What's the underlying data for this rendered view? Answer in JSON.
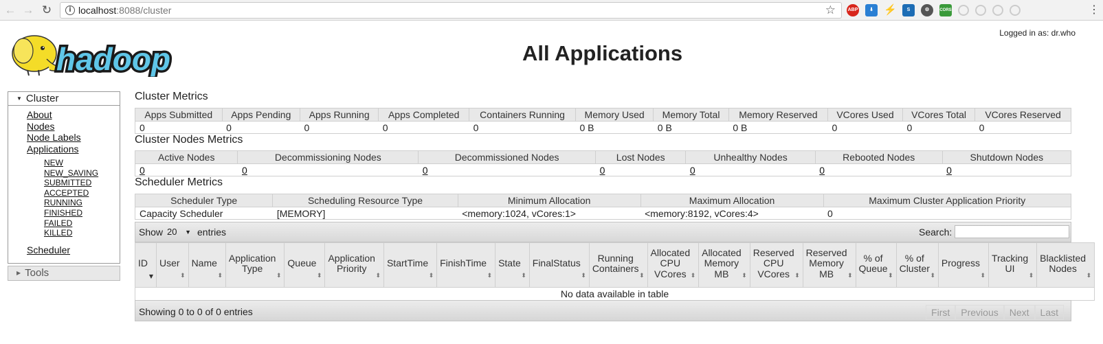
{
  "browser": {
    "url_host": "localhost",
    "url_path": ":8088/cluster"
  },
  "header": {
    "title": "All Applications",
    "logged_in": "Logged in as: dr.who",
    "logo_text": "hadoop"
  },
  "sidebar": {
    "cluster_label": "Cluster",
    "links": [
      "About",
      "Nodes",
      "Node Labels",
      "Applications"
    ],
    "states": [
      "NEW",
      "NEW_SAVING",
      "SUBMITTED",
      "ACCEPTED",
      "RUNNING",
      "FINISHED",
      "FAILED",
      "KILLED"
    ],
    "scheduler": "Scheduler",
    "tools_label": "Tools"
  },
  "cluster_metrics": {
    "title": "Cluster Metrics",
    "headers": [
      "Apps Submitted",
      "Apps Pending",
      "Apps Running",
      "Apps Completed",
      "Containers Running",
      "Memory Used",
      "Memory Total",
      "Memory Reserved",
      "VCores Used",
      "VCores Total",
      "VCores Reserved"
    ],
    "values": [
      "0",
      "0",
      "0",
      "0",
      "0",
      "0 B",
      "0 B",
      "0 B",
      "0",
      "0",
      "0"
    ]
  },
  "node_metrics": {
    "title": "Cluster Nodes Metrics",
    "headers": [
      "Active Nodes",
      "Decommissioning Nodes",
      "Decommissioned Nodes",
      "Lost Nodes",
      "Unhealthy Nodes",
      "Rebooted Nodes",
      "Shutdown Nodes"
    ],
    "values": [
      "0",
      "0",
      "0",
      "0",
      "0",
      "0",
      "0"
    ]
  },
  "scheduler_metrics": {
    "title": "Scheduler Metrics",
    "headers": [
      "Scheduler Type",
      "Scheduling Resource Type",
      "Minimum Allocation",
      "Maximum Allocation",
      "Maximum Cluster Application Priority"
    ],
    "values": [
      "Capacity Scheduler",
      "[MEMORY]",
      "<memory:1024, vCores:1>",
      "<memory:8192, vCores:4>",
      "0"
    ]
  },
  "apps_table": {
    "show_label": "Show",
    "entries_value": "20",
    "entries_label": "entries",
    "search_label": "Search:",
    "search_value": "",
    "columns": [
      "ID",
      "User",
      "Name",
      "Application Type",
      "Queue",
      "Application Priority",
      "StartTime",
      "FinishTime",
      "State",
      "FinalStatus",
      "Running Containers",
      "Allocated CPU VCores",
      "Allocated Memory MB",
      "Reserved CPU VCores",
      "Reserved Memory MB",
      "% of Queue",
      "% of Cluster",
      "Progress",
      "Tracking UI",
      "Blacklisted Nodes"
    ],
    "empty_message": "No data available in table",
    "info": "Showing 0 to 0 of 0 entries",
    "pager": [
      "First",
      "Previous",
      "Next",
      "Last"
    ]
  },
  "colors": {
    "logo_blue": "#5fc6e8",
    "logo_yellow": "#f4dc28",
    "header_gray": "#e8e8e8"
  },
  "icons": [
    "back-arrow-icon",
    "forward-arrow-icon",
    "reload-icon",
    "info-icon",
    "star-icon",
    "adblock-icon",
    "download-icon",
    "bolt-icon",
    "s-extension-icon",
    "gear-extension-icon",
    "cors-icon",
    "menu-dots-icon"
  ]
}
